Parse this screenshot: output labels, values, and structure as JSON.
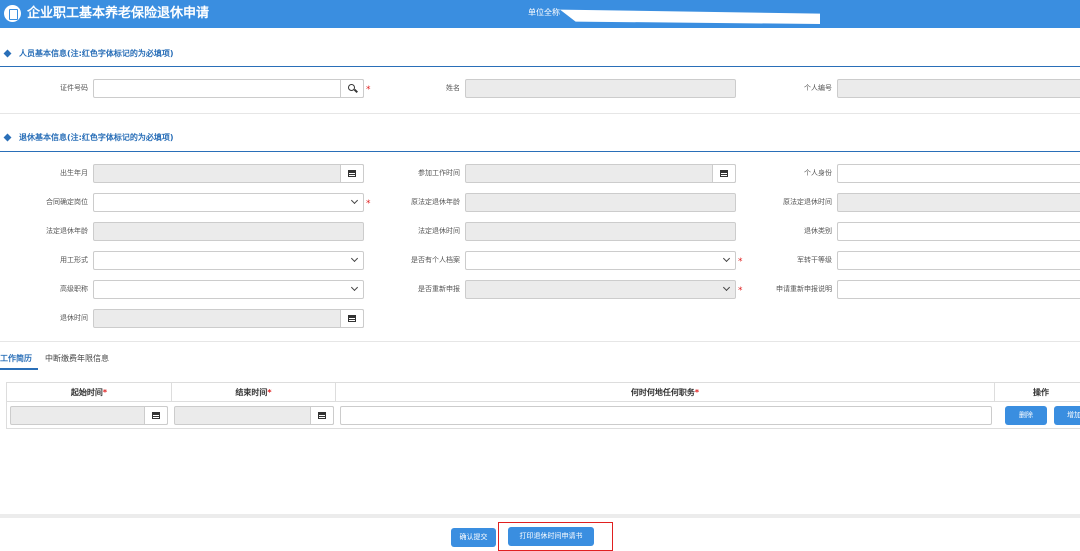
{
  "header": {
    "title": "企业职工基本养老保险退休申请",
    "unit_label": "单位全称"
  },
  "section1": {
    "title": "人员基本信息(注:红色字体标记的为必填项)",
    "fields": {
      "id_number": "证件号码",
      "name": "姓名",
      "personal_no": "个人编号"
    }
  },
  "section2": {
    "title": "退休基本信息(注:红色字体标记的为必填项)",
    "fields": {
      "birth": "出生年月",
      "work_start": "参加工作时间",
      "identity": "个人身份",
      "contract_post": "合同确定岗位",
      "legal_age_orig": "原法定退休年龄",
      "legal_time_orig": "原法定退休时间",
      "legal_age": "法定退休年龄",
      "legal_time": "法定退休时间",
      "retire_type": "退休类别",
      "employment_form": "用工形式",
      "has_file": "是否有个人档案",
      "cadre_level": "军转干等级",
      "senior_title": "高级职称",
      "reapply": "是否重新申报",
      "reapply_note": "申请重新申报说明",
      "retire_time": "退休时间"
    }
  },
  "tabs": [
    "工作简历",
    "中断缴费年限信息"
  ],
  "table": {
    "headers": {
      "start": "起始时间",
      "end": "结束时间",
      "duty": "何时何地任何职务",
      "ops": "操作"
    },
    "req_mark": "*",
    "delete_label": "删除",
    "add_label": "增加"
  },
  "footer": {
    "submit_label": "确认提交",
    "print_label": "打印退休时间申请书"
  },
  "colors": {
    "accent": "#3a8ee0",
    "title_blue": "#2a6fb8",
    "required": "#e02020"
  }
}
